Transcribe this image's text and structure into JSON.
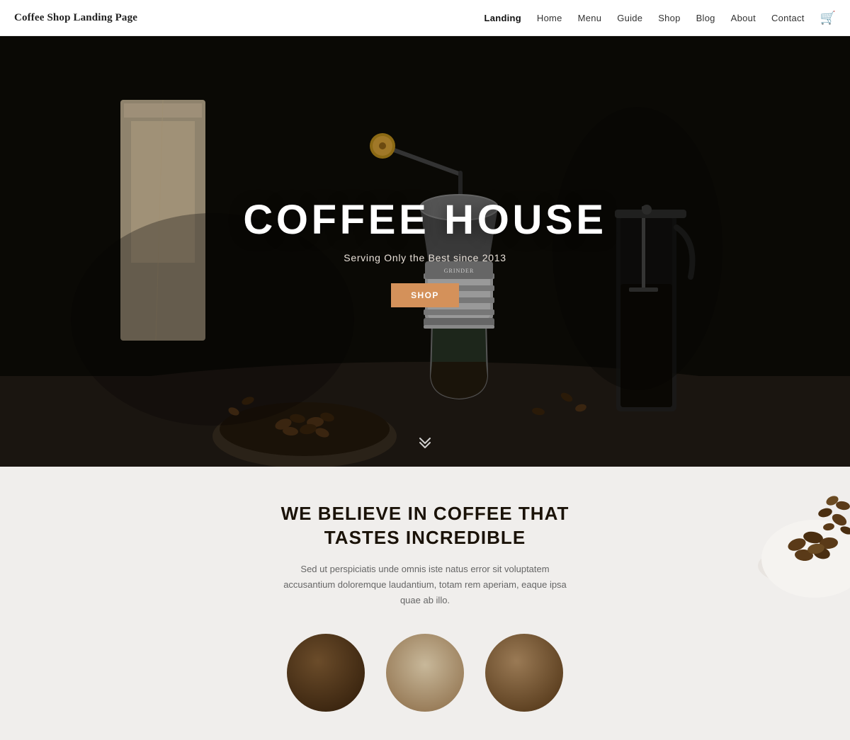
{
  "header": {
    "site_title": "Coffee Shop Landing Page",
    "nav_items": [
      {
        "label": "Landing",
        "active": true
      },
      {
        "label": "Home",
        "active": false
      },
      {
        "label": "Menu",
        "active": false
      },
      {
        "label": "Guide",
        "active": false
      },
      {
        "label": "Shop",
        "active": false
      },
      {
        "label": "Blog",
        "active": false
      },
      {
        "label": "About",
        "active": false
      },
      {
        "label": "Contact",
        "active": false
      }
    ],
    "cart_icon": "🛒"
  },
  "hero": {
    "title": "COFFEE HOUSE",
    "subtitle": "Serving Only the Best since 2013",
    "shop_button": "SHOP",
    "scroll_hint": "↓"
  },
  "lower": {
    "heading": "WE BELIEVE IN COFFEE THAT TASTES INCREDIBLE",
    "body_text": "Sed ut perspiciatis unde omnis iste natus error sit voluptatem accusantium doloremque laudantium, totam rem aperiam, eaque ipsa quae ab illo."
  },
  "colors": {
    "accent": "#d4915a",
    "hero_bg_dark": "#0d0c0a",
    "lower_bg": "#f0eeec",
    "heading_dark": "#1a1208"
  }
}
